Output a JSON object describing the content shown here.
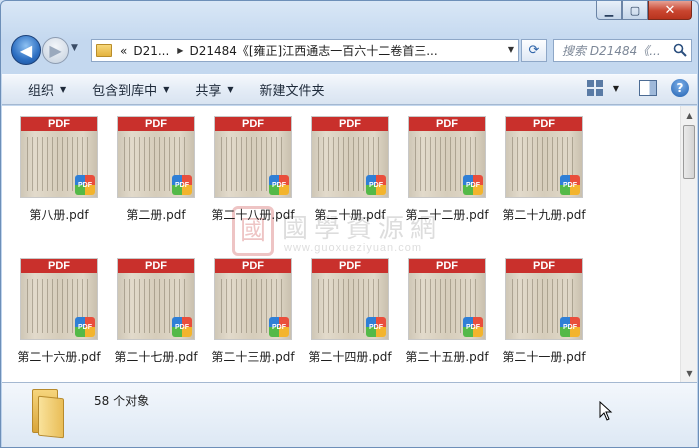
{
  "address_bar": {
    "overflow_label": "«",
    "segment_short": "D21...",
    "path": "D21484《[雍正]江西通志一百六十二卷首三...",
    "search_placeholder": "搜索 D21484《..."
  },
  "toolbar": {
    "organize": "组织",
    "include_in_library": "包含到库中",
    "share": "共享",
    "new_folder": "新建文件夹"
  },
  "thumb_banner": "PDF",
  "thumb_badge": "PDF",
  "files": [
    {
      "name": "第八册.pdf"
    },
    {
      "name": "第二册.pdf"
    },
    {
      "name": "第二十八册.pdf"
    },
    {
      "name": "第二十册.pdf"
    },
    {
      "name": "第二十二册.pdf"
    },
    {
      "name": "第二十九册.pdf"
    },
    {
      "name": "第二十六册.pdf"
    },
    {
      "name": "第二十七册.pdf"
    },
    {
      "name": "第二十三册.pdf"
    },
    {
      "name": "第二十四册.pdf"
    },
    {
      "name": "第二十五册.pdf"
    },
    {
      "name": "第二十一册.pdf"
    }
  ],
  "watermark": {
    "seal": "國",
    "title": "國學資源網",
    "url": "www.guoxueziyuan.com"
  },
  "status": {
    "item_count": "58 个对象"
  },
  "icons": {
    "back": "back-arrow-icon",
    "forward": "forward-arrow-icon",
    "refresh": "refresh-icon",
    "search": "search-icon",
    "view": "view-options-icon",
    "preview_pane": "preview-pane-icon",
    "help": "help-icon"
  }
}
